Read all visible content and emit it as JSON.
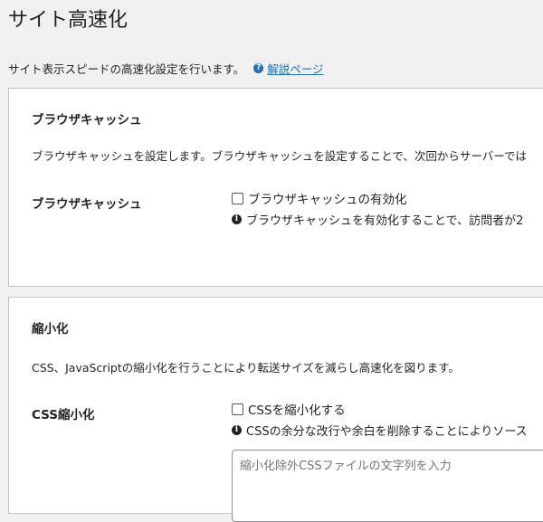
{
  "page": {
    "title": "サイト高速化",
    "description": "サイト表示スピードの高速化設定を行います。",
    "help_icon": "question-circle-icon",
    "help_link": "解説ページ"
  },
  "sections": [
    {
      "title": "ブラウザキャッシュ",
      "description": "ブラウザキャッシュを設定します。ブラウザキャッシュを設定することで、次回からサーバーでは",
      "row_label": "ブラウザキャッシュ",
      "checkbox_label": "ブラウザキャッシュの有効化",
      "checked": false,
      "note": "ブラウザキャッシュを有効化することで、訪問者が2"
    },
    {
      "title": "縮小化",
      "description": "CSS、JavaScriptの縮小化を行うことにより転送サイズを減らし高速化を図ります。",
      "row_label": "CSS縮小化",
      "checkbox_label": "CSSを縮小化する",
      "checked": false,
      "note": "CSSの余分な改行や余白を削除することによりソース",
      "textarea_placeholder": "縮小化除外CSSファイルの文字列を入力"
    }
  ],
  "colors": {
    "accent": "#2271b1",
    "background": "#f0f0f1",
    "card": "#ffffff",
    "border": "#c3c4c7"
  }
}
